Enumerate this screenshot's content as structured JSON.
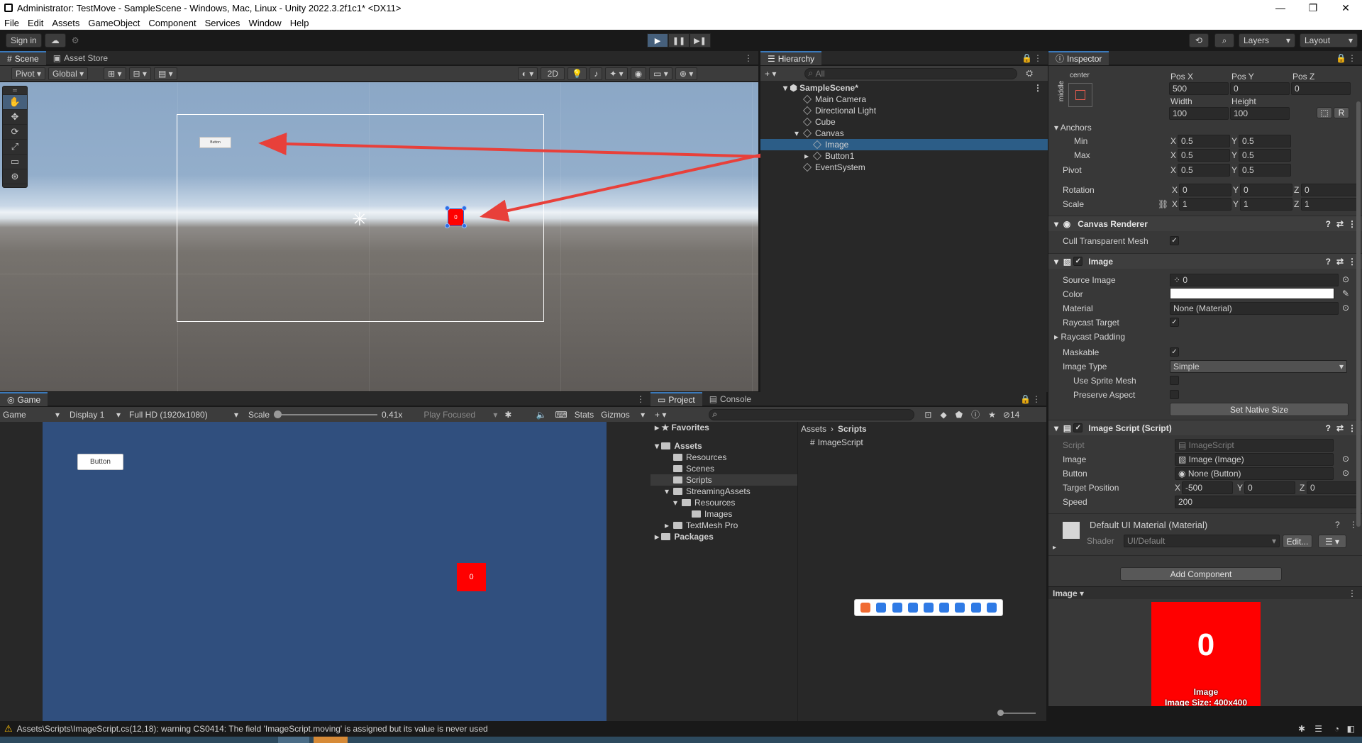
{
  "window": {
    "title": "Administrator: TestMove - SampleScene - Windows, Mac, Linux - Unity 2022.3.2f1c1* <DX11>",
    "controls": [
      "—",
      "❐",
      "✕"
    ]
  },
  "menu": [
    "File",
    "Edit",
    "Assets",
    "GameObject",
    "Component",
    "Services",
    "Window",
    "Help"
  ],
  "toolbar": {
    "sign_in": "Sign in",
    "layers": "Layers",
    "layout": "Layout"
  },
  "scene": {
    "tabs": [
      "Scene",
      "Asset Store"
    ],
    "pivot": "Pivot",
    "global": "Global",
    "mode_2d": "2D",
    "button_text": "Button",
    "image_text": "0"
  },
  "game": {
    "tab": "Game",
    "mode": "Game",
    "display": "Display 1",
    "resolution": "Full HD (1920x1080)",
    "scale_label": "Scale",
    "scale_value": "0.41x",
    "play_focused": "Play Focused",
    "stats": "Stats",
    "gizmos": "Gizmos",
    "button_text": "Button",
    "image_text": "0"
  },
  "hierarchy": {
    "tab": "Hierarchy",
    "search_placeholder": "All",
    "scene": "SampleScene*",
    "items": [
      "Main Camera",
      "Directional Light",
      "Cube",
      "Canvas",
      "Image",
      "Button1",
      "EventSystem"
    ]
  },
  "project": {
    "tabs": [
      "Project",
      "Console"
    ],
    "hidden_count": "14",
    "favorites": "Favorites",
    "assets": "Assets",
    "folders": [
      "Resources",
      "Scenes",
      "Scripts",
      "StreamingAssets",
      "Resources",
      "Images",
      "TextMesh Pro"
    ],
    "packages": "Packages",
    "breadcrumb": [
      "Assets",
      "Scripts"
    ],
    "files": [
      "ImageScript"
    ]
  },
  "inspector": {
    "tab": "Inspector",
    "anchor_preset": "center",
    "anchor_side": "middle",
    "pos_labels": [
      "Pos X",
      "Pos Y",
      "Pos Z"
    ],
    "pos_values": [
      "500",
      "0",
      "0"
    ],
    "size_labels": [
      "Width",
      "Height"
    ],
    "size_values": [
      "100",
      "100"
    ],
    "raw_edit": "R",
    "anchors": "Anchors",
    "min": "Min",
    "max": "Max",
    "pivot": "Pivot",
    "rotation": "Rotation",
    "scale": "Scale",
    "x": "X",
    "y": "Y",
    "z": "Z",
    "anchor_min": [
      "0.5",
      "0.5"
    ],
    "anchor_max": [
      "0.5",
      "0.5"
    ],
    "pivot_vals": [
      "0.5",
      "0.5"
    ],
    "rotation_vals": [
      "0",
      "0",
      "0"
    ],
    "scale_vals": [
      "1",
      "1",
      "1"
    ],
    "canvas_renderer": "Canvas Renderer",
    "cull_transparent": "Cull Transparent Mesh",
    "image_comp": "Image",
    "source_image": "Source Image",
    "source_image_val": "0",
    "color": "Color",
    "material": "Material",
    "material_val": "None (Material)",
    "raycast_target": "Raycast Target",
    "raycast_padding": "Raycast Padding",
    "maskable": "Maskable",
    "image_type": "Image Type",
    "image_type_val": "Simple",
    "use_sprite_mesh": "Use Sprite Mesh",
    "preserve_aspect": "Preserve Aspect",
    "set_native_size": "Set Native Size",
    "image_script": "Image Script (Script)",
    "script": "Script",
    "script_val": "ImageScript",
    "image_field": "Image",
    "image_field_val": "Image (Image)",
    "button_field": "Button",
    "button_field_val": "None (Button)",
    "target_position": "Target Position",
    "target_vals": [
      "-500",
      "0",
      "0"
    ],
    "speed": "Speed",
    "speed_val": "200",
    "default_material": "Default UI Material (Material)",
    "shader": "Shader",
    "shader_val": "UI/Default",
    "edit": "Edit...",
    "add_component": "Add Component",
    "preview_label": "Image",
    "preview_zero": "0",
    "preview_name": "Image",
    "preview_size": "Image Size: 400x400"
  },
  "status": {
    "message": "Assets\\Scripts\\ImageScript.cs(12,18): warning CS0414: The field 'ImageScript.moving' is assigned but its value is never used"
  },
  "colors": {
    "accent": "#3a79bb",
    "selection": "#2c5d87",
    "game_bg": "#304f7e",
    "image_red": "#ff0000",
    "arrow": "#e8403a"
  }
}
